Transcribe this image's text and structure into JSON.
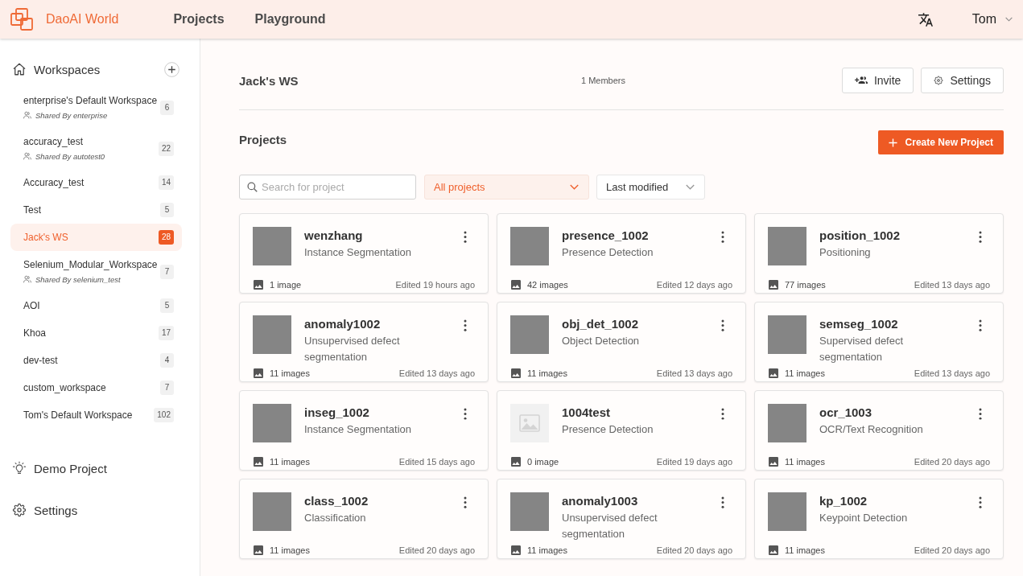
{
  "header": {
    "brand": "DaoAI World",
    "nav": [
      {
        "label": "Projects"
      },
      {
        "label": "Playground"
      }
    ],
    "user": "Tom"
  },
  "sidebar": {
    "title": "Workspaces",
    "workspaces": [
      {
        "name": "enterprise's Default Workspace",
        "shared_by": "Shared By enterprise",
        "count": "6",
        "selected": false
      },
      {
        "name": "accuracy_test",
        "shared_by": "Shared By autotest0",
        "count": "22",
        "selected": false
      },
      {
        "name": "Accuracy_test",
        "count": "14",
        "selected": false
      },
      {
        "name": "Test",
        "count": "5",
        "selected": false
      },
      {
        "name": "Jack's WS",
        "count": "28",
        "selected": true
      },
      {
        "name": "Selenium_Modular_Workspace",
        "shared_by": "Shared By selenium_test",
        "count": "7",
        "selected": false
      },
      {
        "name": "AOI",
        "count": "5",
        "selected": false
      },
      {
        "name": "Khoa",
        "count": "17",
        "selected": false
      },
      {
        "name": "dev-test",
        "count": "4",
        "selected": false
      },
      {
        "name": "custom_workspace",
        "count": "7",
        "selected": false
      },
      {
        "name": "Tom's Default Workspace",
        "count": "102",
        "selected": false
      }
    ],
    "links": [
      {
        "kind": "demo",
        "label": "Demo Project"
      },
      {
        "kind": "settings",
        "label": "Settings"
      }
    ]
  },
  "workspace": {
    "name": "Jack's WS",
    "members": "1 Members",
    "actions": [
      {
        "kind": "invite",
        "label": "Invite"
      },
      {
        "kind": "settings",
        "label": "Settings"
      }
    ]
  },
  "projects": {
    "title": "Projects",
    "create_button": "Create New Project",
    "search": {
      "placeholder": "Search for project"
    },
    "filters": [
      {
        "value": "All projects",
        "highlighted": true
      },
      {
        "value": "Last modified",
        "highlighted": false
      }
    ],
    "items": [
      {
        "kind": "photo",
        "name": "wenzhang",
        "type": "Instance Segmentation",
        "images": "1 image",
        "edited": "Edited 19 hours ago"
      },
      {
        "kind": "photo",
        "name": "presence_1002",
        "type": "Presence Detection",
        "images": "42 images",
        "edited": "Edited 12 days ago"
      },
      {
        "kind": "photo",
        "name": "position_1002",
        "type": "Positioning",
        "images": "77 images",
        "edited": "Edited 13 days ago"
      },
      {
        "kind": "photo",
        "name": "anomaly1002",
        "type": "Unsupervised defect segmentation",
        "images": "11 images",
        "edited": "Edited 13 days ago"
      },
      {
        "kind": "photo",
        "name": "obj_det_1002",
        "type": "Object Detection",
        "images": "11 images",
        "edited": "Edited 13 days ago"
      },
      {
        "kind": "photo",
        "name": "semseg_1002",
        "type": "Supervised defect segmentation",
        "images": "11 images",
        "edited": "Edited 13 days ago"
      },
      {
        "kind": "photo",
        "name": "inseg_1002",
        "type": "Instance Segmentation",
        "images": "11 images",
        "edited": "Edited 15 days ago"
      },
      {
        "kind": "placeholder",
        "name": "1004test",
        "type": "Presence Detection",
        "images": "0 image",
        "edited": "Edited 19 days ago"
      },
      {
        "kind": "photo",
        "name": "ocr_1003",
        "type": "OCR/Text Recognition",
        "images": "11 images",
        "edited": "Edited 20 days ago"
      },
      {
        "kind": "photo",
        "name": "class_1002",
        "type": "Classification",
        "images": "11 images",
        "edited": "Edited 20 days ago"
      },
      {
        "kind": "photo",
        "name": "anomaly1003",
        "type": "Unsupervised defect segmentation",
        "images": "11 images",
        "edited": "Edited 20 days ago"
      },
      {
        "kind": "photo",
        "name": "kp_1002",
        "type": "Keypoint Detection",
        "images": "11 images",
        "edited": "Edited 20 days ago"
      }
    ]
  }
}
